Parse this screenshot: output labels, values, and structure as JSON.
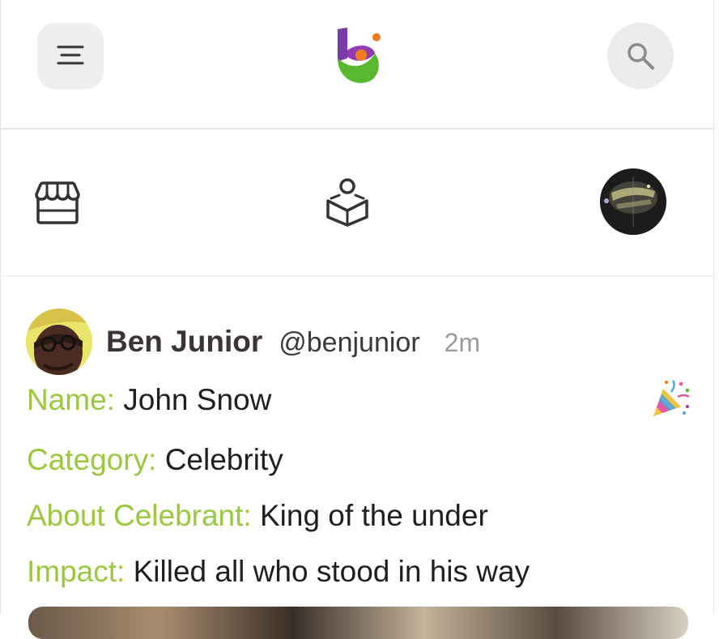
{
  "header": {
    "menu_icon": "hamburger-menu-icon",
    "logo_icon": "app-logo",
    "search_icon": "search-icon"
  },
  "nav": {
    "store_icon": "storefront-icon",
    "learn_icon": "reading-person-icon",
    "profile_icon": "profile-avatar"
  },
  "post": {
    "author_name": "Ben Junior",
    "author_handle": "@benjunior",
    "time_ago": "2m",
    "celebrate_icon": "party-popper-icon",
    "fields": [
      {
        "label": "Name:",
        "value": "John Snow"
      },
      {
        "label": "Category:",
        "value": "Celebrity"
      },
      {
        "label": "About Celebrant:",
        "value": "King of the under"
      },
      {
        "label": "Impact:",
        "value": "Killed all who stood in his way"
      }
    ]
  },
  "colors": {
    "label_green": "#9bc83e",
    "author_color": "#3b3335",
    "time_grey": "#9a9a9a",
    "button_bg": "#efefef"
  }
}
